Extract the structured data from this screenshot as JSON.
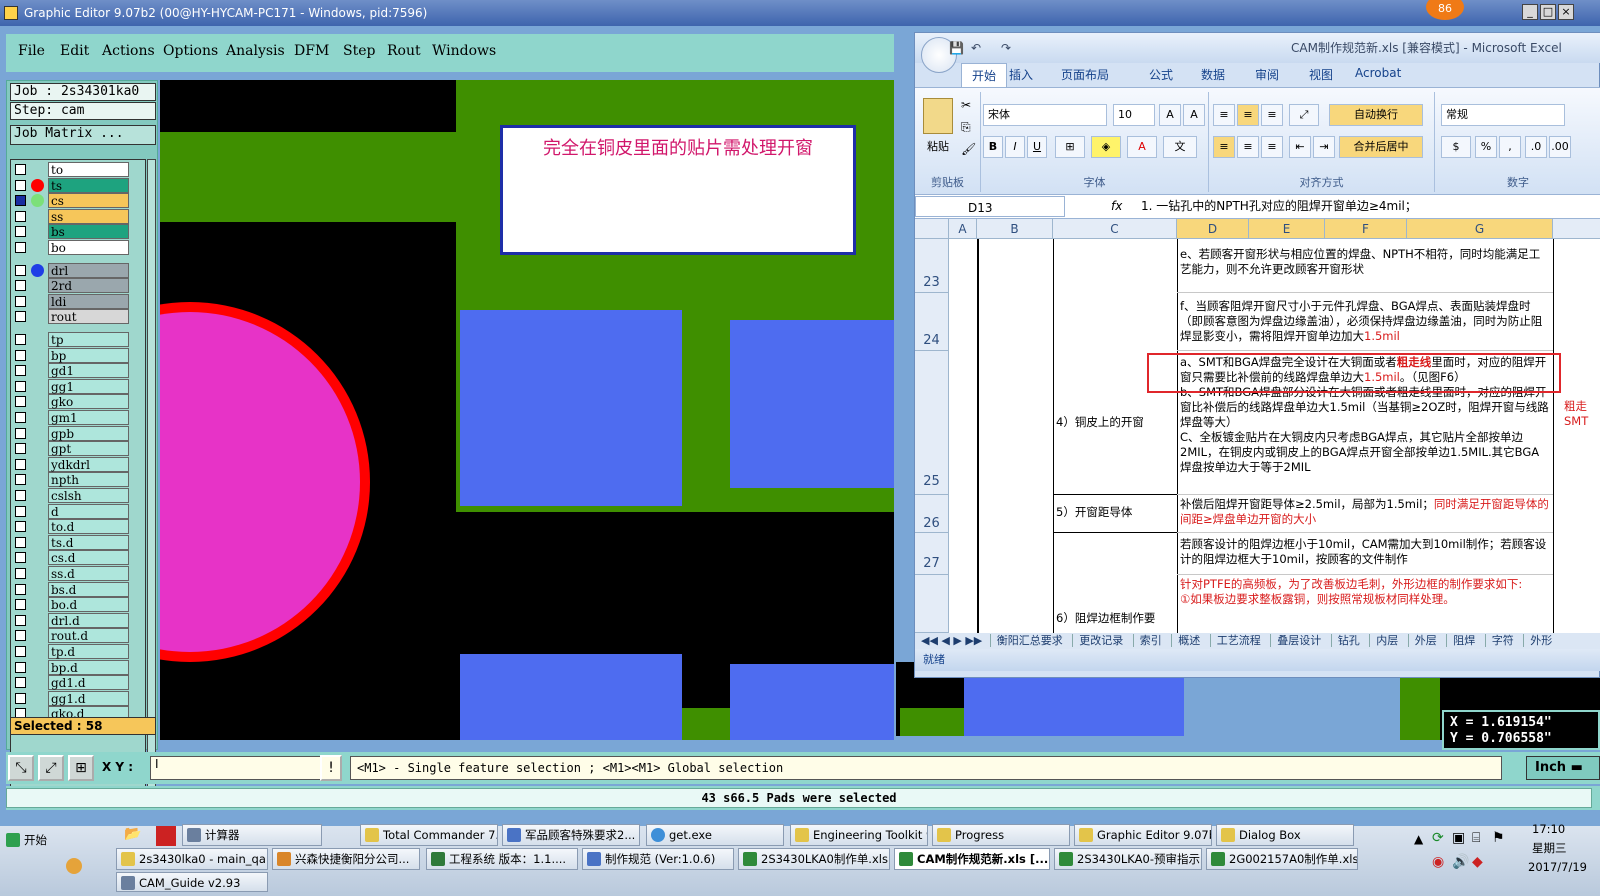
{
  "window": {
    "title": "Graphic Editor 9.07b2 (00@HY-HYCAM-PC171 - Windows, pid:7596)"
  },
  "menu": [
    "File",
    "Edit",
    "Actions",
    "Options",
    "Analysis",
    "DFM",
    "Step",
    "Rout",
    "Windows"
  ],
  "job": {
    "job_label": "Job : 2s34301ka0",
    "step_label": "Step: cam",
    "matrix_label": "Job Matrix ..."
  },
  "layers": [
    "to",
    "ts",
    "cs",
    "ss",
    "bs",
    "bo",
    "drl",
    "2rd",
    "ldi",
    "rout",
    "tp",
    "bp",
    "gd1",
    "gg1",
    "gko",
    "gm1",
    "gpb",
    "gpt",
    "ydkdrl",
    "npth",
    "cslsh",
    "d",
    "to.d",
    "ts.d",
    "cs.d",
    "ss.d",
    "bs.d",
    "bo.d",
    "drl.d",
    "rout.d",
    "tp.d",
    "bp.d",
    "gd1.d",
    "gg1.d",
    "gko.d"
  ],
  "selected_label": "Selected : 58",
  "canvas_note": "完全在铜皮里面的贴片需处理开窗",
  "coordinates": {
    "x": "X = 1.619154\"",
    "y": "Y = 0.706558\""
  },
  "command": {
    "xy_label": "X Y :",
    "xy_value": "I",
    "message": "<M1> - Single feature selection ; <M1><M1> Global selection",
    "unit": "Inch"
  },
  "status": "43 s66.5 Pads were selected",
  "badge": "86",
  "excel": {
    "title": "CAM制作规范新.xls  [兼容模式] - Microsoft Excel",
    "tabs": [
      "开始",
      "插入",
      "页面布局",
      "公式",
      "数据",
      "审阅",
      "视图",
      "Acrobat"
    ],
    "groups": [
      "剪贴板",
      "字体",
      "对齐方式",
      "数字"
    ],
    "paste": "粘贴",
    "font_name": "宋体",
    "font_size": "10",
    "wrap": "自动换行",
    "merge": "合并后居中",
    "number_format": "常规",
    "name_box": "D13",
    "formula": "1. 一钻孔中的NPTH孔对应的阻焊开窗单边≥4mil；",
    "columns": [
      "A",
      "B",
      "C",
      "D",
      "E",
      "F",
      "G"
    ],
    "rows": [
      "23",
      "24",
      "25",
      "26",
      "27"
    ],
    "cells": {
      "r23": "e、若顾客开窗形状与相应位置的焊盘、NPTH不相符，同时均能满足工艺能力，则不允许更改顾客开窗形状",
      "r24_a": "f、当顾客阻焊开窗尺寸小于元件孔焊盘、BGA焊点、表面贴装焊盘时（即顾客意图为焊盘边缘盖油），必须保持焊盘边缘盖油，同时为防止阻焊显影变小，需将阻焊开窗单边加大",
      "r24_b": "1.5mil",
      "c25": "4）铜皮上的开窗",
      "r25_a": "a、SMT和BGA焊盘完全设计在大铜面或者",
      "r25_a_red": "粗走线",
      "r25_a2": "里面时，对应的阻焊开窗只需要比补偿前的线路焊盘单边大",
      "r25_a_val": "1.5mil",
      "r25_a3": "。（见图F6）",
      "r25_b": "b、SMT和BGA焊盘部分设计在大铜面或者粗走线里面时，对应的阻焊开窗比补偿后的线路焊盘单边大1.5mil（当基铜≥2OZ时，阻焊开窗与线路焊盘等大）",
      "r25_c": "C、全板镀金贴片在大铜皮内只考虑BGA焊点，其它贴片全部按单边2MIL，在铜皮内或铜皮上的BGA焊点开窗全部按单边1.5MIL.其它BGA焊盘按单边大于等于2MIL",
      "c26": "5）开窗距导体",
      "r26_a": "补偿后阻焊开窗距导体≥2.5mil，局部为1.5mil；",
      "r26_b": "同时满足开窗距导体的间距≥焊盘单边开窗的大小",
      "r27": "若顾客设计的阻焊边框小于10mil，CAM需加大到10mil制作；若顾客设计的阻焊边框大于10mil，按顾客的文件制作",
      "c28": "6）阻焊边框制作要",
      "r28_a": "针对PTFE的高频板，为了改善板边毛刺，外形边框的制作要求如下:",
      "r28_b": "①如果板边要求整板露铜，则按照常规板材同样处理。",
      "side": "粗走",
      "side2": "SMT"
    },
    "sheets": [
      "衡阳汇总要求",
      "更改记录",
      "索引",
      "概述",
      "工艺流程",
      "叠层设计",
      "钻孔",
      "内层",
      "外层",
      "阻焊",
      "字符",
      "外形"
    ],
    "status": "就绪"
  },
  "taskbar": {
    "start": "开始",
    "row1": [
      "计算器",
      "Total Commander 7.0...",
      "军品顾客特殊要求2...",
      "get.exe",
      "Engineering Toolkit 9....",
      "Progress",
      "Graphic Editor 9.07b2...",
      "Dialog Box"
    ],
    "row2": [
      "2s3430lka0 - main_qa",
      "兴森快捷衡阳分公司...",
      "工程系统  版本：1.1....",
      "制作规范 (Ver:1.0.6)",
      "2S3430LKA0制作单.xls ...",
      "CAM制作规范新.xls [...",
      "2S3430LKA0-预审指示...",
      "2G002157A0制作单.xls ..."
    ],
    "row3": [
      "CAM_Guide v2.93"
    ],
    "time": "17:10",
    "weekday": "星期三",
    "date": "2017/7/19"
  }
}
